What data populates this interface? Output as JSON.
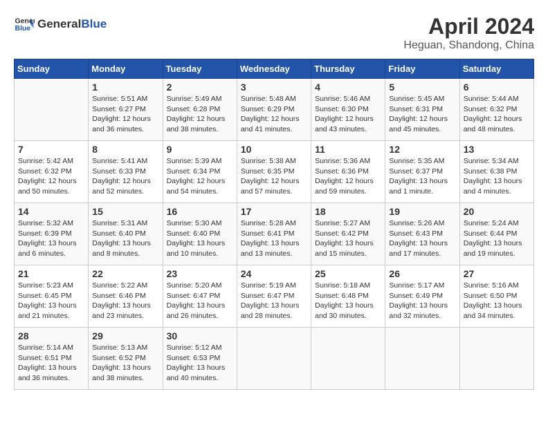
{
  "header": {
    "logo_general": "General",
    "logo_blue": "Blue",
    "month": "April 2024",
    "location": "Heguan, Shandong, China"
  },
  "weekdays": [
    "Sunday",
    "Monday",
    "Tuesday",
    "Wednesday",
    "Thursday",
    "Friday",
    "Saturday"
  ],
  "weeks": [
    [
      {
        "day": "",
        "sunrise": "",
        "sunset": "",
        "daylight": ""
      },
      {
        "day": "1",
        "sunrise": "Sunrise: 5:51 AM",
        "sunset": "Sunset: 6:27 PM",
        "daylight": "Daylight: 12 hours and 36 minutes."
      },
      {
        "day": "2",
        "sunrise": "Sunrise: 5:49 AM",
        "sunset": "Sunset: 6:28 PM",
        "daylight": "Daylight: 12 hours and 38 minutes."
      },
      {
        "day": "3",
        "sunrise": "Sunrise: 5:48 AM",
        "sunset": "Sunset: 6:29 PM",
        "daylight": "Daylight: 12 hours and 41 minutes."
      },
      {
        "day": "4",
        "sunrise": "Sunrise: 5:46 AM",
        "sunset": "Sunset: 6:30 PM",
        "daylight": "Daylight: 12 hours and 43 minutes."
      },
      {
        "day": "5",
        "sunrise": "Sunrise: 5:45 AM",
        "sunset": "Sunset: 6:31 PM",
        "daylight": "Daylight: 12 hours and 45 minutes."
      },
      {
        "day": "6",
        "sunrise": "Sunrise: 5:44 AM",
        "sunset": "Sunset: 6:32 PM",
        "daylight": "Daylight: 12 hours and 48 minutes."
      }
    ],
    [
      {
        "day": "7",
        "sunrise": "Sunrise: 5:42 AM",
        "sunset": "Sunset: 6:32 PM",
        "daylight": "Daylight: 12 hours and 50 minutes."
      },
      {
        "day": "8",
        "sunrise": "Sunrise: 5:41 AM",
        "sunset": "Sunset: 6:33 PM",
        "daylight": "Daylight: 12 hours and 52 minutes."
      },
      {
        "day": "9",
        "sunrise": "Sunrise: 5:39 AM",
        "sunset": "Sunset: 6:34 PM",
        "daylight": "Daylight: 12 hours and 54 minutes."
      },
      {
        "day": "10",
        "sunrise": "Sunrise: 5:38 AM",
        "sunset": "Sunset: 6:35 PM",
        "daylight": "Daylight: 12 hours and 57 minutes."
      },
      {
        "day": "11",
        "sunrise": "Sunrise: 5:36 AM",
        "sunset": "Sunset: 6:36 PM",
        "daylight": "Daylight: 12 hours and 59 minutes."
      },
      {
        "day": "12",
        "sunrise": "Sunrise: 5:35 AM",
        "sunset": "Sunset: 6:37 PM",
        "daylight": "Daylight: 13 hours and 1 minute."
      },
      {
        "day": "13",
        "sunrise": "Sunrise: 5:34 AM",
        "sunset": "Sunset: 6:38 PM",
        "daylight": "Daylight: 13 hours and 4 minutes."
      }
    ],
    [
      {
        "day": "14",
        "sunrise": "Sunrise: 5:32 AM",
        "sunset": "Sunset: 6:39 PM",
        "daylight": "Daylight: 13 hours and 6 minutes."
      },
      {
        "day": "15",
        "sunrise": "Sunrise: 5:31 AM",
        "sunset": "Sunset: 6:40 PM",
        "daylight": "Daylight: 13 hours and 8 minutes."
      },
      {
        "day": "16",
        "sunrise": "Sunrise: 5:30 AM",
        "sunset": "Sunset: 6:40 PM",
        "daylight": "Daylight: 13 hours and 10 minutes."
      },
      {
        "day": "17",
        "sunrise": "Sunrise: 5:28 AM",
        "sunset": "Sunset: 6:41 PM",
        "daylight": "Daylight: 13 hours and 13 minutes."
      },
      {
        "day": "18",
        "sunrise": "Sunrise: 5:27 AM",
        "sunset": "Sunset: 6:42 PM",
        "daylight": "Daylight: 13 hours and 15 minutes."
      },
      {
        "day": "19",
        "sunrise": "Sunrise: 5:26 AM",
        "sunset": "Sunset: 6:43 PM",
        "daylight": "Daylight: 13 hours and 17 minutes."
      },
      {
        "day": "20",
        "sunrise": "Sunrise: 5:24 AM",
        "sunset": "Sunset: 6:44 PM",
        "daylight": "Daylight: 13 hours and 19 minutes."
      }
    ],
    [
      {
        "day": "21",
        "sunrise": "Sunrise: 5:23 AM",
        "sunset": "Sunset: 6:45 PM",
        "daylight": "Daylight: 13 hours and 21 minutes."
      },
      {
        "day": "22",
        "sunrise": "Sunrise: 5:22 AM",
        "sunset": "Sunset: 6:46 PM",
        "daylight": "Daylight: 13 hours and 23 minutes."
      },
      {
        "day": "23",
        "sunrise": "Sunrise: 5:20 AM",
        "sunset": "Sunset: 6:47 PM",
        "daylight": "Daylight: 13 hours and 26 minutes."
      },
      {
        "day": "24",
        "sunrise": "Sunrise: 5:19 AM",
        "sunset": "Sunset: 6:47 PM",
        "daylight": "Daylight: 13 hours and 28 minutes."
      },
      {
        "day": "25",
        "sunrise": "Sunrise: 5:18 AM",
        "sunset": "Sunset: 6:48 PM",
        "daylight": "Daylight: 13 hours and 30 minutes."
      },
      {
        "day": "26",
        "sunrise": "Sunrise: 5:17 AM",
        "sunset": "Sunset: 6:49 PM",
        "daylight": "Daylight: 13 hours and 32 minutes."
      },
      {
        "day": "27",
        "sunrise": "Sunrise: 5:16 AM",
        "sunset": "Sunset: 6:50 PM",
        "daylight": "Daylight: 13 hours and 34 minutes."
      }
    ],
    [
      {
        "day": "28",
        "sunrise": "Sunrise: 5:14 AM",
        "sunset": "Sunset: 6:51 PM",
        "daylight": "Daylight: 13 hours and 36 minutes."
      },
      {
        "day": "29",
        "sunrise": "Sunrise: 5:13 AM",
        "sunset": "Sunset: 6:52 PM",
        "daylight": "Daylight: 13 hours and 38 minutes."
      },
      {
        "day": "30",
        "sunrise": "Sunrise: 5:12 AM",
        "sunset": "Sunset: 6:53 PM",
        "daylight": "Daylight: 13 hours and 40 minutes."
      },
      {
        "day": "",
        "sunrise": "",
        "sunset": "",
        "daylight": ""
      },
      {
        "day": "",
        "sunrise": "",
        "sunset": "",
        "daylight": ""
      },
      {
        "day": "",
        "sunrise": "",
        "sunset": "",
        "daylight": ""
      },
      {
        "day": "",
        "sunrise": "",
        "sunset": "",
        "daylight": ""
      }
    ]
  ]
}
